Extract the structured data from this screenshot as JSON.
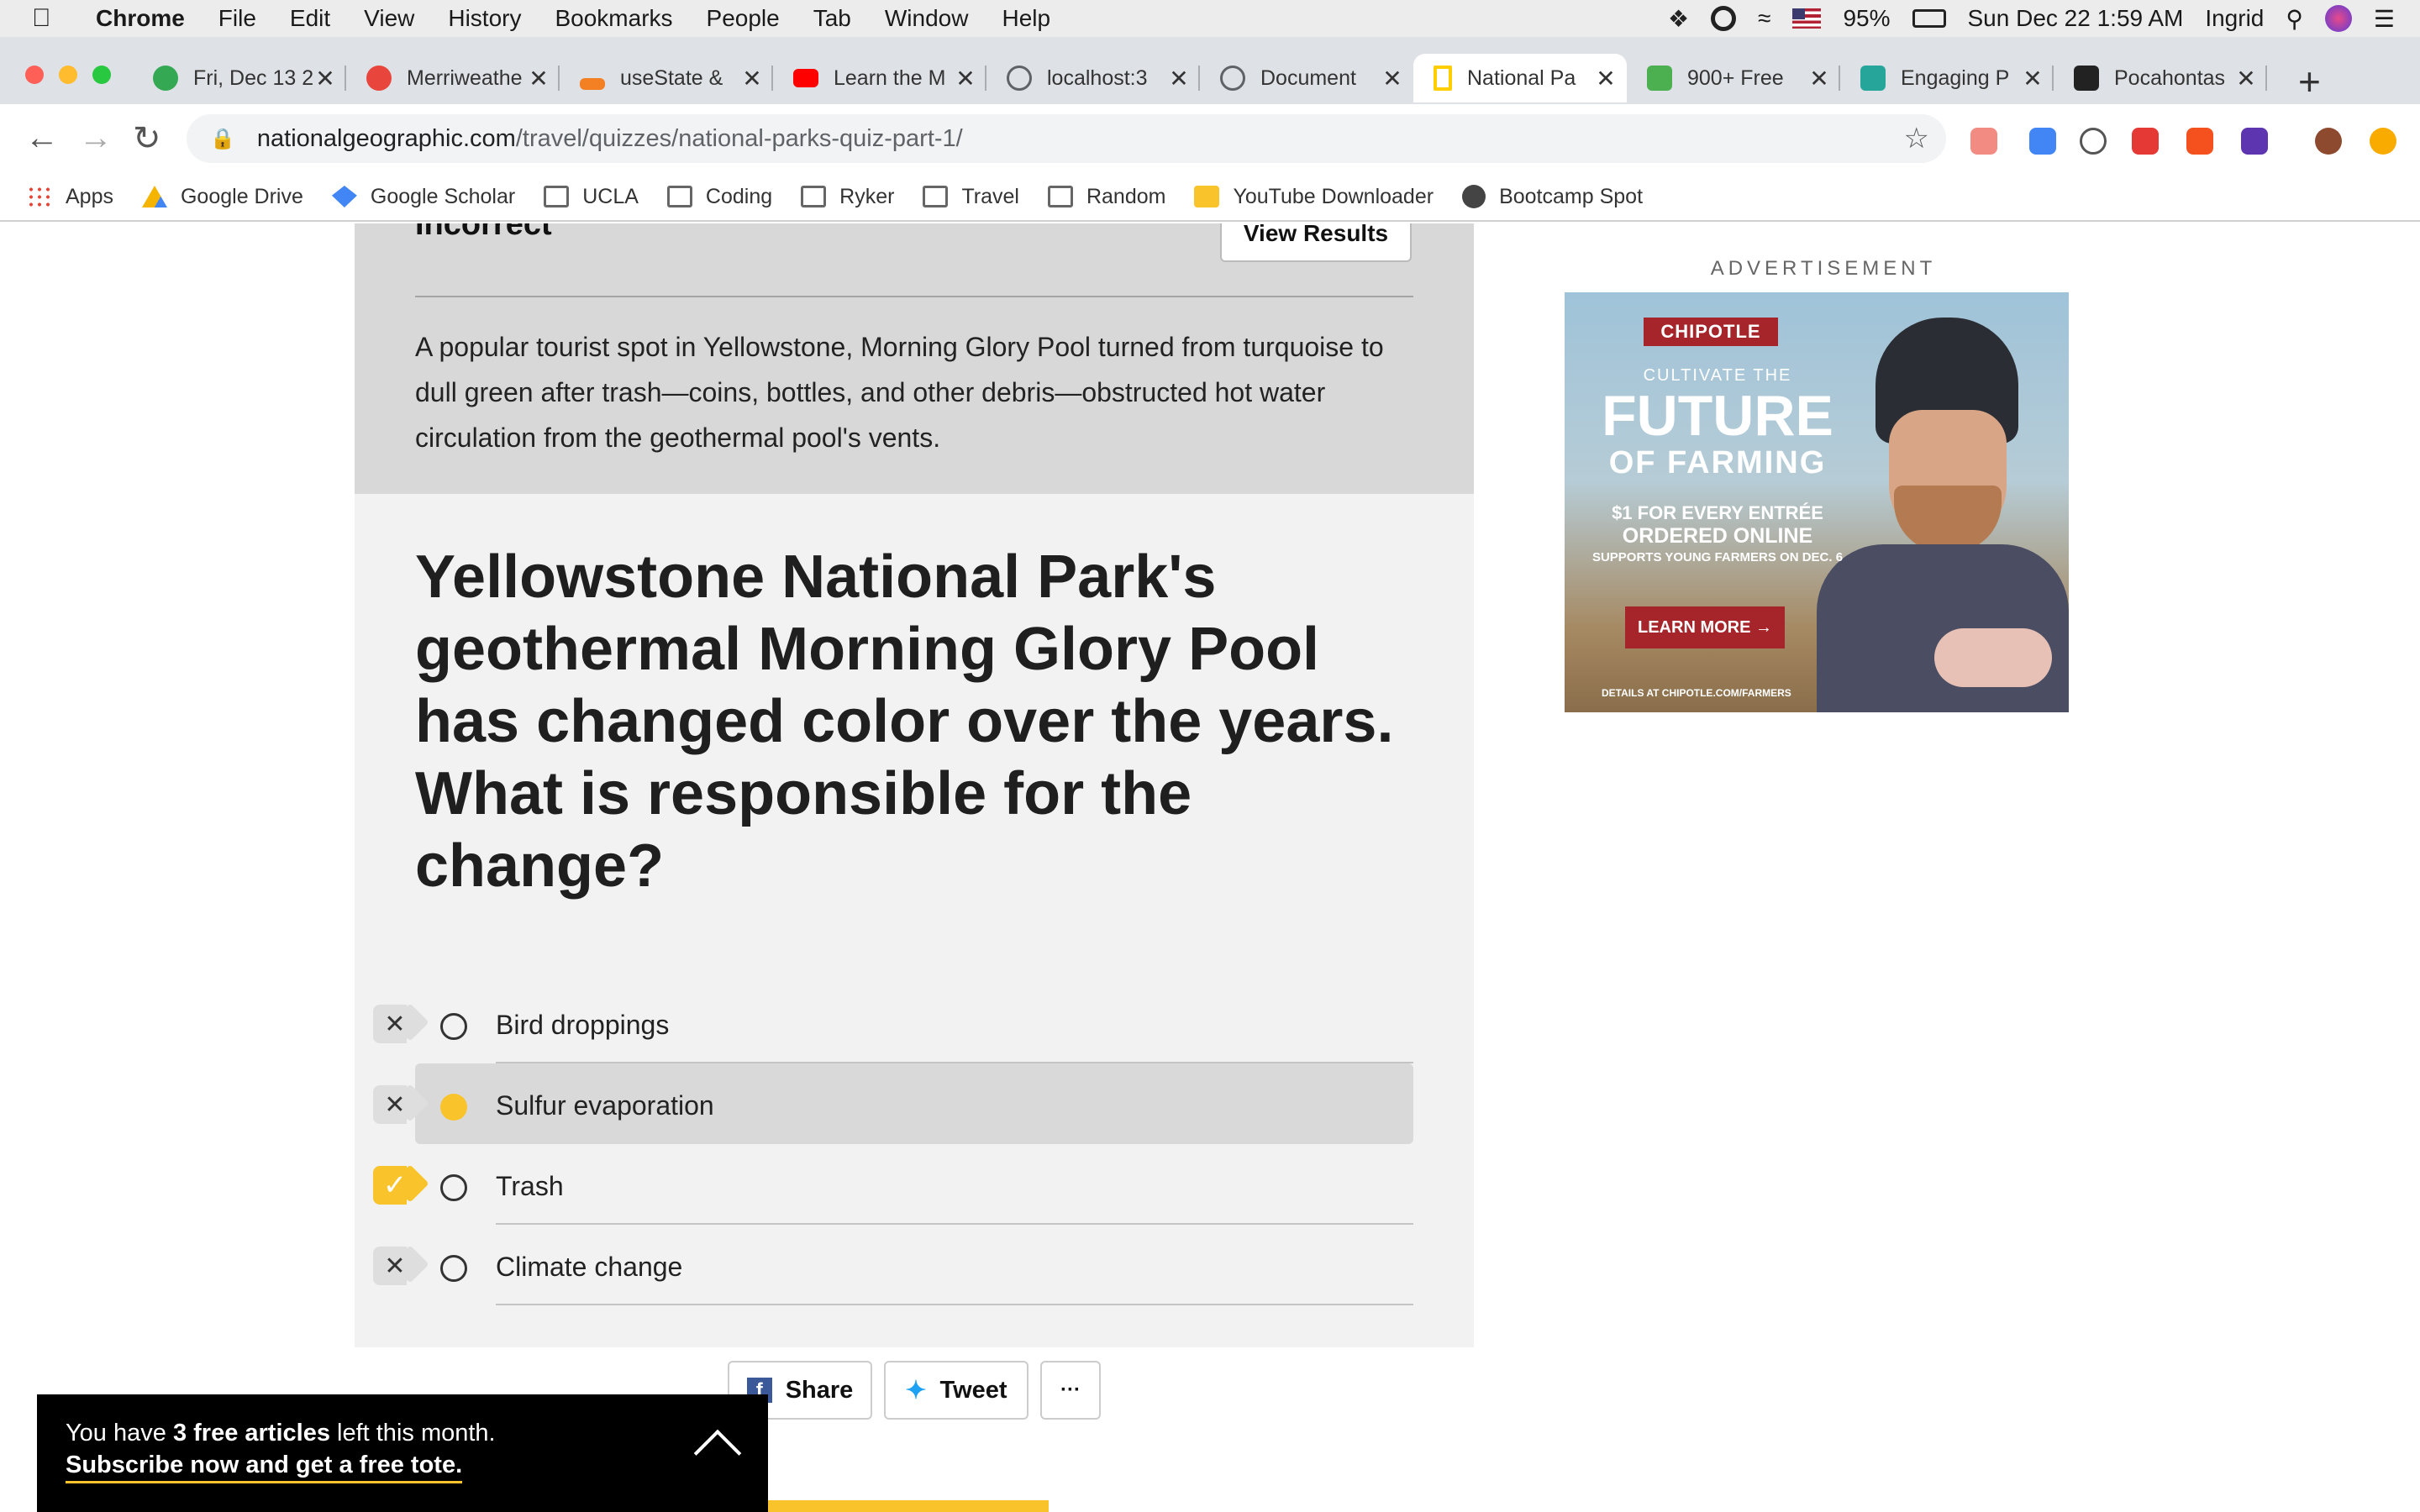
{
  "menubar": {
    "items": [
      "Chrome",
      "File",
      "Edit",
      "View",
      "History",
      "Bookmarks",
      "People",
      "Tab",
      "Window",
      "Help"
    ],
    "battery": "95%",
    "datetime": "Sun Dec 22  1:59 AM",
    "user": "Ingrid"
  },
  "tabs": [
    {
      "title": "Fri, Dec 13 2",
      "color": "#34a853"
    },
    {
      "title": "Merriweathe",
      "color": "#e8453c"
    },
    {
      "title": "useState &",
      "color": "#f48024"
    },
    {
      "title": "Learn the M",
      "color": "#ff0000"
    },
    {
      "title": "localhost:3",
      "color": "#5f6368"
    },
    {
      "title": "Document",
      "color": "#5f6368"
    },
    {
      "title": "National Pa",
      "color": "#ffce00"
    },
    {
      "title": "900+ Free",
      "color": "#4caf50"
    },
    {
      "title": "Engaging P",
      "color": "#26a69a"
    },
    {
      "title": "Pocahontas",
      "color": "#222222"
    }
  ],
  "address": {
    "host": "nationalgeographic.com",
    "path": "/travel/quizzes/national-parks-quiz-part-1/"
  },
  "bookmarks": [
    "Apps",
    "Google Drive",
    "Google Scholar",
    "UCLA",
    "Coding",
    "Ryker",
    "Travel",
    "Random",
    "YouTube Downloader",
    "Bootcamp Spot"
  ],
  "quiz": {
    "result_label": "Incorrect",
    "view_results": "View Results",
    "explanation": "A popular tourist spot in Yellowstone, Morning Glory Pool turned from turquoise to dull green after trash—coins, bottles, and other debris—obstructed hot water circulation from the geothermal pool's vents.",
    "question": "Yellowstone National Park's geothermal Morning Glory Pool has changed color over the years. What is responsible for the change?",
    "answers": [
      {
        "label": "Bird droppings",
        "mark": "✕"
      },
      {
        "label": "Sulfur evaporation",
        "mark": "✕"
      },
      {
        "label": "Trash",
        "mark": "✓"
      },
      {
        "label": "Climate change",
        "mark": "✕"
      }
    ]
  },
  "share": {
    "share": "Share",
    "tweet": "Tweet",
    "more": "···",
    "fb": "f"
  },
  "ad": {
    "label": "ADVERTISEMENT",
    "brand": "CHIPOTLE",
    "line1": "CULTIVATE THE",
    "line2": "FUTURE",
    "line3": "OF FARMING",
    "line4": "$1 FOR EVERY ENTRÉE",
    "line5": "ORDERED ONLINE",
    "line6": "SUPPORTS YOUNG FARMERS ON DEC. 6",
    "cta": "LEARN MORE →",
    "fine": "DETAILS AT CHIPOTLE.COM/FARMERS"
  },
  "paywall": {
    "prefix": "You have ",
    "count": "3 free articles",
    "suffix": " left this month.",
    "cta": "Subscribe now and get a free tote."
  }
}
